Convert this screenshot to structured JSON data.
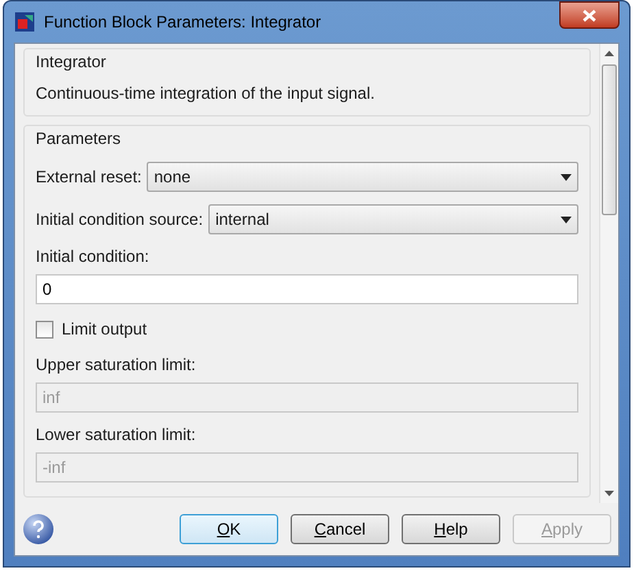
{
  "window": {
    "title": "Function Block Parameters: Integrator"
  },
  "description_group": {
    "title": "Integrator",
    "text": "Continuous-time integration of the input signal."
  },
  "parameters_group": {
    "title": "Parameters",
    "items": [
      {
        "kind": "dropdown",
        "label": "External reset:",
        "value": "none",
        "disabled": false
      },
      {
        "kind": "dropdown",
        "label": "Initial condition source:",
        "value": "internal",
        "disabled": false
      },
      {
        "kind": "text",
        "label": "Initial condition:",
        "value": "0",
        "disabled": false
      },
      {
        "kind": "checkbox",
        "label": "Limit output",
        "checked": false
      },
      {
        "kind": "text",
        "label": "Upper saturation limit:",
        "value": "inf",
        "disabled": true
      },
      {
        "kind": "text",
        "label": "Lower saturation limit:",
        "value": "-inf",
        "disabled": true
      }
    ]
  },
  "buttons": [
    {
      "label": "OK",
      "focused": true,
      "disabled": false
    },
    {
      "label": "Cancel",
      "focused": false,
      "disabled": false
    },
    {
      "label": "Help",
      "focused": false,
      "disabled": false
    },
    {
      "label": "Apply",
      "focused": false,
      "disabled": true
    }
  ]
}
